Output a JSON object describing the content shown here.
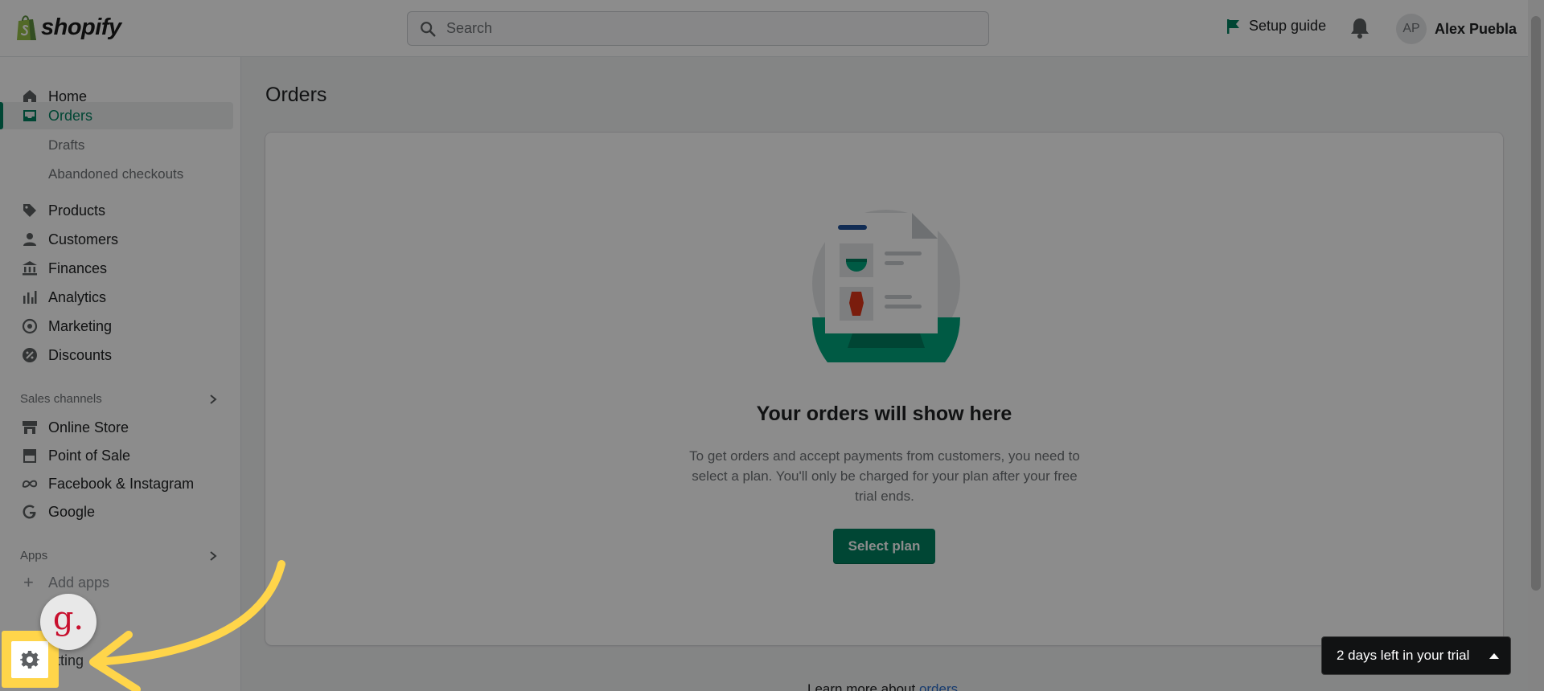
{
  "brand": {
    "logo_text": "shopify",
    "accent": "#008060",
    "logo_green": "#95bf47"
  },
  "topbar": {
    "search_placeholder": "Search",
    "setup_guide_label": "Setup guide",
    "user_initials": "AP",
    "user_name": "Alex Puebla"
  },
  "sidebar": {
    "items": [
      {
        "label": "Home",
        "icon": "home-icon"
      },
      {
        "label": "Orders",
        "icon": "orders-icon",
        "active": true
      },
      {
        "label": "Products",
        "icon": "tag-icon"
      },
      {
        "label": "Customers",
        "icon": "person-icon"
      },
      {
        "label": "Finances",
        "icon": "bank-icon"
      },
      {
        "label": "Analytics",
        "icon": "bar-chart-icon"
      },
      {
        "label": "Marketing",
        "icon": "target-icon"
      },
      {
        "label": "Discounts",
        "icon": "discount-icon"
      }
    ],
    "order_sub_items": [
      "Drafts",
      "Abandoned checkouts"
    ],
    "sales_channels_label": "Sales channels",
    "channels": [
      {
        "label": "Online Store",
        "icon": "store-icon"
      },
      {
        "label": "Point of Sale",
        "icon": "pos-icon"
      },
      {
        "label": "Facebook & Instagram",
        "icon": "meta-icon"
      },
      {
        "label": "Google",
        "icon": "google-icon"
      }
    ],
    "apps_label": "Apps",
    "add_apps_label": "Add apps",
    "settings_label": "etting"
  },
  "main": {
    "page_title": "Orders",
    "empty_title": "Your orders will show here",
    "empty_description": "To get orders and accept payments from customers, you need to select a plan. You'll only be charged for your plan after your free trial ends.",
    "select_plan_label": "Select plan",
    "learn_more_prefix": "Learn more about",
    "learn_more_link": "orders"
  },
  "widget": {
    "letter": "g."
  },
  "trial_banner": {
    "label": "2 days left in your trial"
  }
}
